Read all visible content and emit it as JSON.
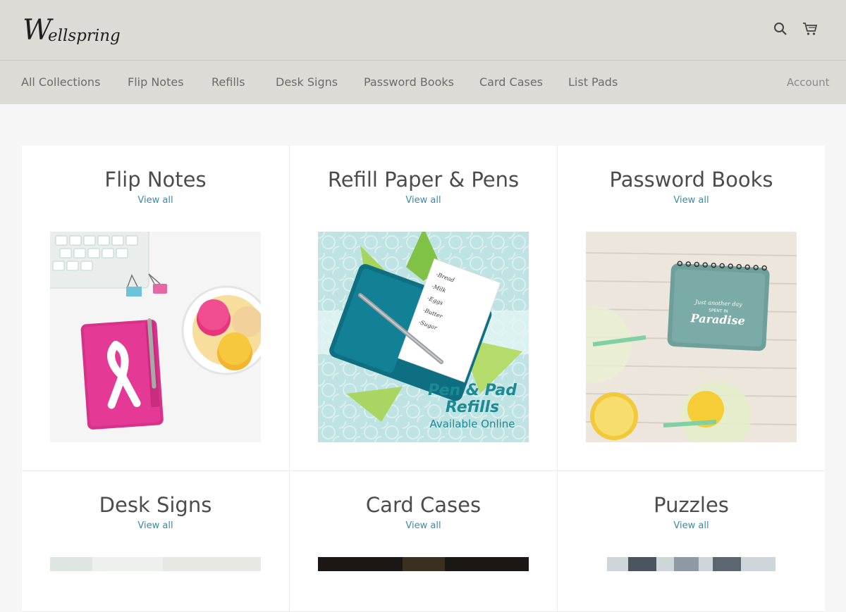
{
  "header": {
    "logo_text": "Wellspring",
    "search_icon": "search-icon",
    "cart_icon": "cart-icon"
  },
  "nav": {
    "items": [
      {
        "label": "All Collections"
      },
      {
        "label": "Flip Notes"
      },
      {
        "label": "Refills"
      },
      {
        "label": "Desk Signs"
      },
      {
        "label": "Password Books"
      },
      {
        "label": "Card Cases"
      },
      {
        "label": "List Pads"
      }
    ],
    "account_label": "Account"
  },
  "collections": [
    {
      "title": "Flip Notes",
      "link": "View all"
    },
    {
      "title": "Refill Paper & Pens",
      "link": "View all",
      "image_text": [
        "Pen & Pad",
        "Refills",
        "Available Online"
      ]
    },
    {
      "title": "Password Books",
      "link": "View all",
      "image_text": [
        "Just another day",
        "SPENT IN",
        "Paradise"
      ]
    },
    {
      "title": "Desk Signs",
      "link": "View all"
    },
    {
      "title": "Card Cases",
      "link": "View all"
    },
    {
      "title": "Puzzles",
      "link": "View all"
    }
  ],
  "colors": {
    "header_bg": "#dcdbd6",
    "page_bg": "#f6f6f6",
    "link": "#3a8aa8"
  }
}
